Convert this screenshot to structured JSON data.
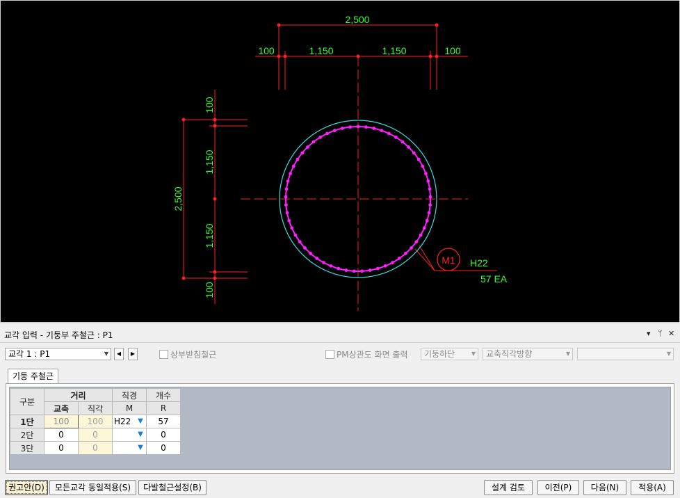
{
  "drawing": {
    "dims": {
      "top_total": "2,500",
      "top_left_cover": "100",
      "top_left_span": "1,150",
      "top_right_span": "1,150",
      "top_right_cover": "100",
      "left_total": "2,500",
      "left_top_cover": "100",
      "left_top_span": "1,150",
      "left_bottom_span": "1,150",
      "left_bottom_cover": "100"
    },
    "marker": "M1",
    "rebar_dia": "H22",
    "rebar_count": "57 EA",
    "colors": {
      "background": "#000000",
      "dimension_line": "#ff2020",
      "dimension_text": "#33ff33",
      "outer_circle": "#33e0e0",
      "rebar_circle": "#ff20ff"
    }
  },
  "panel": {
    "title": "교각 입력 - 기둥부 주철근 : P1",
    "title_controls": {
      "dropdown": "▾",
      "pin": "ᛘ",
      "close": "✕"
    },
    "pier_combo": "교각 1 : P1",
    "nav_prev": "◀",
    "nav_next": "▶",
    "chk_top_support": "상부받침철근",
    "chk_pm": "PM상관도 화면 출력",
    "combo_bottom": "기둥하단",
    "combo_direction": "교축직각방향",
    "combo_empty": "",
    "tab_label": "기둥 주철근"
  },
  "grid": {
    "hdr_gubun": "구분",
    "hdr_distance": "거리",
    "hdr_diameter": "직경",
    "hdr_count": "개수",
    "hdr_axial": "교축",
    "hdr_perp": "직각",
    "hdr_m": "M",
    "hdr_r": "R",
    "rows": [
      {
        "label": "1단",
        "axial": "100",
        "perp": "100",
        "dia": "H22",
        "count": "57"
      },
      {
        "label": "2단",
        "axial": "0",
        "perp": "0",
        "dia": "",
        "count": "0"
      },
      {
        "label": "3단",
        "axial": "0",
        "perp": "0",
        "dia": "",
        "count": "0"
      }
    ]
  },
  "buttons": {
    "recommend": "권고안(D)",
    "apply_all": "모든교각 동일적용(S)",
    "multi_rebar": "다발철근설정(B)",
    "design_check": "설계 검토",
    "prev": "이전(P)",
    "next": "다음(N)",
    "apply": "적용(A)"
  }
}
